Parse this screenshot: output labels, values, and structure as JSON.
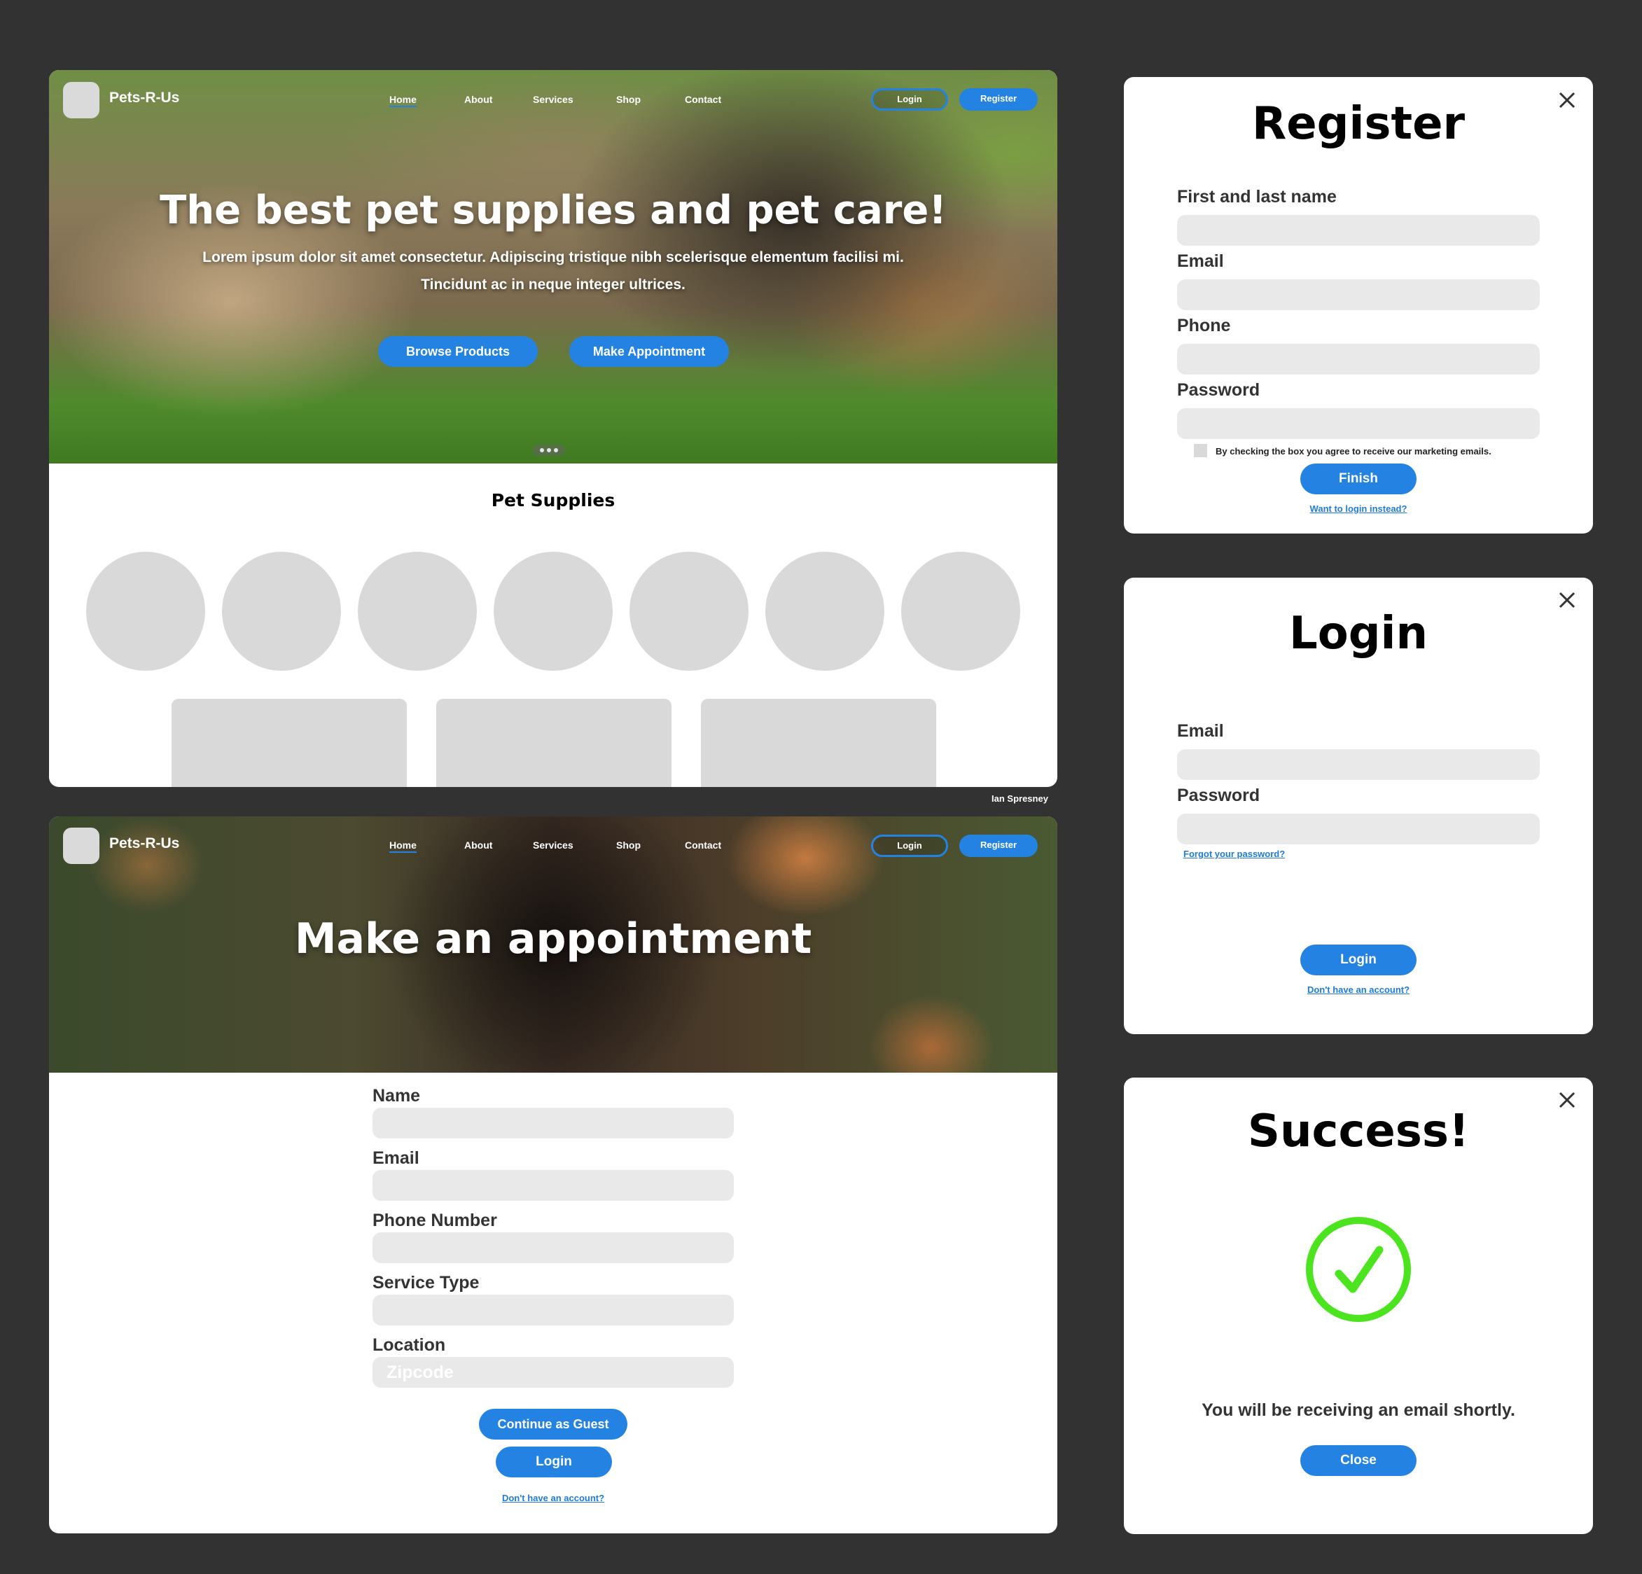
{
  "site": {
    "brand": "Pets-R-Us",
    "nav": [
      "Home",
      "About",
      "Services",
      "Shop",
      "Contact"
    ],
    "login_label": "Login",
    "register_label": "Register"
  },
  "home": {
    "hero_title": "The best pet supplies and pet care!",
    "hero_subtitle": "Lorem ipsum dolor sit amet consectetur. Adipiscing tristique nibh scelerisque elementum facilisi mi. Tincidunt ac in neque integer ultrices.",
    "browse_button": "Browse Products",
    "appointment_button": "Make Appointment",
    "section_title": "Pet Supplies"
  },
  "credit": "Ian Spresney",
  "appointment": {
    "hero_title": "Make an appointment",
    "fields": [
      "Name",
      "Email",
      "Phone Number",
      "Service Type",
      "Location"
    ],
    "location_placeholder": "Zipcode",
    "guest_button": "Continue as Guest",
    "login_button": "Login",
    "no_account_link": "Don't have an account?"
  },
  "register": {
    "title": "Register",
    "fields": [
      "First and last name",
      "Email",
      "Phone",
      "Password"
    ],
    "checkbox_text": "By checking the box you agree to receive our marketing emails.",
    "finish_button": "Finish",
    "login_link": "Want to login instead?"
  },
  "login": {
    "title": "Login",
    "fields": [
      "Email",
      "Password"
    ],
    "forgot_link": "Forgot your password?",
    "login_button": "Login",
    "no_account_link": "Don't have an account?"
  },
  "success": {
    "title": "Success!",
    "message": "You will be receiving an email shortly.",
    "close_button": "Close"
  },
  "colors": {
    "accent": "#2483e2",
    "success_green": "#4be41e",
    "canvas_bg": "#323232",
    "input_bg": "#e9e9e9",
    "placeholder_gray": "#d9d9d9"
  },
  "icons": [
    "close-icon",
    "checkmark-circle-icon",
    "logo-placeholder-icon"
  ]
}
